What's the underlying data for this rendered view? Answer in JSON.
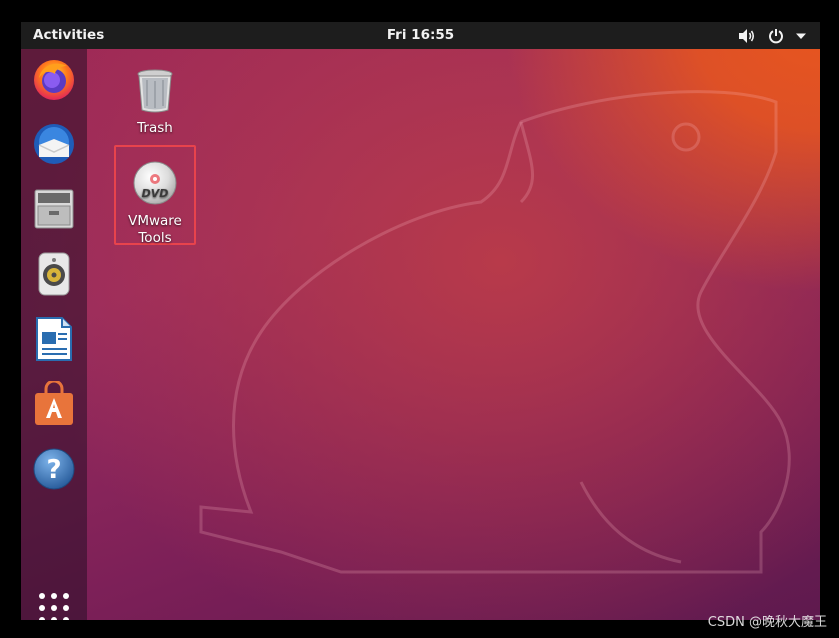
{
  "topbar": {
    "activities_label": "Activities",
    "clock": "Fri 16:55",
    "tray_icons": [
      "volume-icon",
      "power-icon",
      "menu-arrow-icon"
    ]
  },
  "dock": {
    "items": [
      {
        "name": "firefox-icon"
      },
      {
        "name": "thunderbird-icon"
      },
      {
        "name": "files-icon"
      },
      {
        "name": "rhythmbox-icon"
      },
      {
        "name": "libreoffice-writer-icon"
      },
      {
        "name": "software-center-icon"
      },
      {
        "name": "help-icon"
      }
    ],
    "show_apps_icon": "app-grid-icon"
  },
  "desktop": {
    "icons": [
      {
        "label": "Trash"
      },
      {
        "label_line1": "VMware",
        "label_line2": "Tools"
      }
    ]
  },
  "colors": {
    "topbar": "#1d1d1d",
    "selection_border": "#e8434c",
    "wallpaper_orange": "#e8561e",
    "wallpaper_purple": "#7a1f57"
  },
  "watermark": {
    "text": "CSDN @晚秋大魔王"
  }
}
